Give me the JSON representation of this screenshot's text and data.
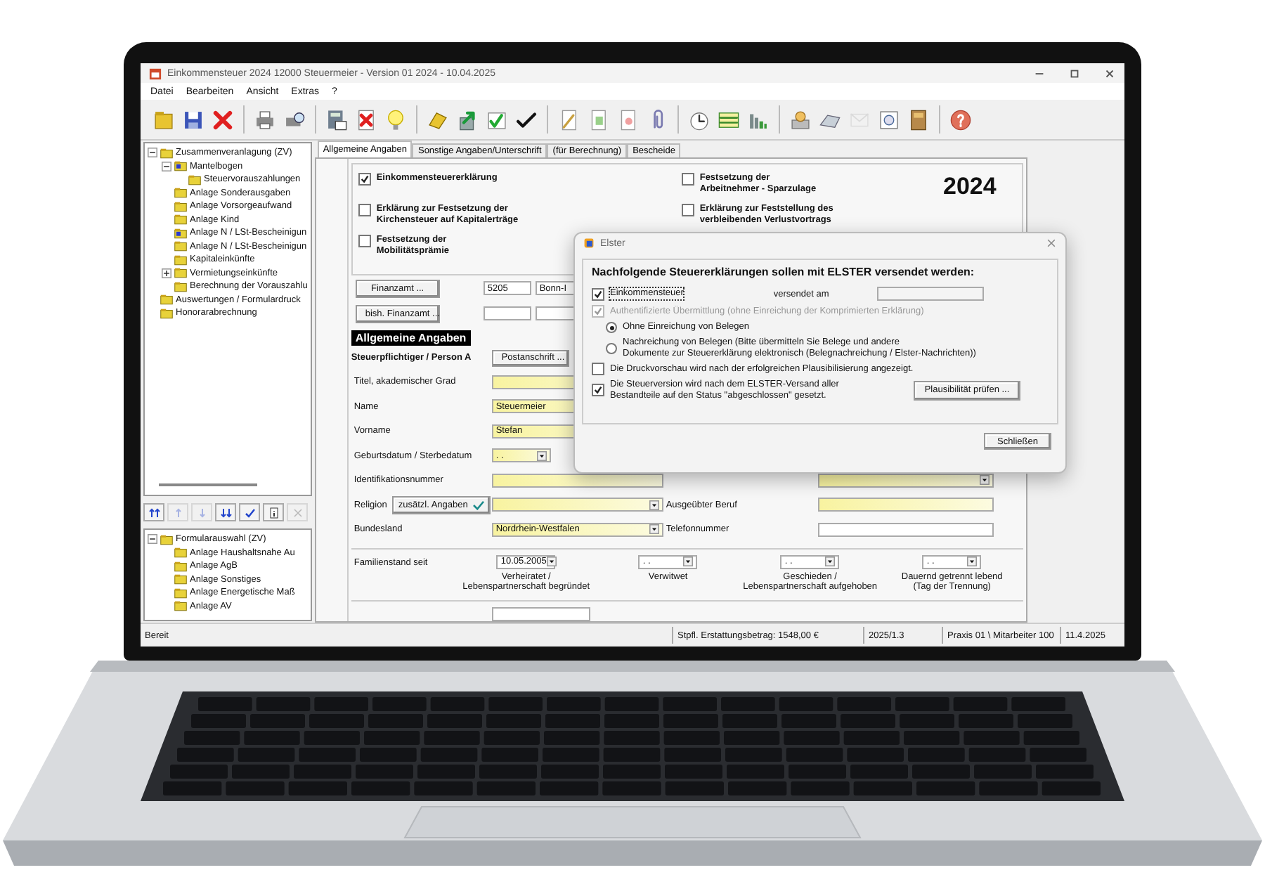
{
  "window": {
    "title": "Einkommensteuer 2024 12000 Steuermeier - Version 01 2024 - 10.04.2025"
  },
  "menu": [
    "Datei",
    "Bearbeiten",
    "Ansicht",
    "Extras",
    "?"
  ],
  "toolbar": [
    {
      "disabled": false
    },
    {
      "disabled": false
    },
    {
      "disabled": false
    },
    {
      "disabled": false
    },
    {
      "disabled": false
    },
    {
      "disabled": false
    },
    {
      "disabled": false
    },
    {
      "disabled": false
    },
    {
      "disabled": false
    },
    {
      "disabled": false
    },
    {
      "disabled": false
    },
    {
      "disabled": false
    },
    {
      "disabled": false
    },
    {
      "disabled": false
    },
    {
      "disabled": false
    },
    {
      "disabled": false
    },
    {
      "disabled": false
    },
    {
      "disabled": false
    },
    {
      "disabled": false
    },
    {
      "disabled": false
    },
    {
      "disabled": false
    },
    {
      "disabled": true
    },
    {
      "disabled": false
    },
    {
      "disabled": false
    },
    {
      "disabled": false
    }
  ],
  "navigation_tree": [
    {
      "label": "Zusammenveranlagung (ZV)",
      "marked": false,
      "expanded": true,
      "children": [
        {
          "label": "Mantelbogen",
          "marked": true,
          "expanded": true,
          "children": [
            {
              "label": "Steuervorauszahlungen",
              "marked": false
            }
          ]
        },
        {
          "label": "Anlage Sonderausgaben",
          "marked": false
        },
        {
          "label": "Anlage Vorsorgeaufwand",
          "marked": false
        },
        {
          "label": "Anlage Kind",
          "marked": false
        },
        {
          "label": "Anlage N / LSt-Bescheinigun",
          "marked": true
        },
        {
          "label": "Anlage N / LSt-Bescheinigun",
          "marked": false
        },
        {
          "label": "Kapitaleinkünfte",
          "marked": false
        },
        {
          "label": "Vermietungseinkünfte",
          "marked": false,
          "expanded": false
        },
        {
          "label": "Berechnung der Vorauszahlu",
          "marked": false
        }
      ]
    },
    {
      "label": "Auswertungen / Formulardruck",
      "marked": false
    },
    {
      "label": "Honorarabrechnung",
      "marked": false
    }
  ],
  "tree_toolbar": [
    {
      "disabled": false
    },
    {
      "disabled": true
    },
    {
      "disabled": true
    },
    {
      "disabled": false
    },
    {
      "disabled": false
    },
    {
      "disabled": false
    },
    {
      "disabled": true
    }
  ],
  "form_tree": [
    {
      "label": "Formularauswahl (ZV)",
      "marked": false,
      "expanded": true,
      "children": [
        {
          "label": "Anlage Haushaltsnahe Au",
          "marked": false
        },
        {
          "label": "Anlage AgB",
          "marked": false
        },
        {
          "label": "Anlage Sonstiges",
          "marked": false
        },
        {
          "label": "Anlage Energetische Maß",
          "marked": false
        },
        {
          "label": "Anlage AV",
          "marked": false
        }
      ]
    }
  ],
  "tabs": [
    {
      "label": "Allgemeine Angaben",
      "selected": true
    },
    {
      "label": "Sonstige Angaben/Unterschrift",
      "selected": false
    },
    {
      "label": "(für Berechnung)",
      "selected": false
    },
    {
      "label": "Bescheide",
      "selected": false
    }
  ],
  "declarations": [
    {
      "label": "Einkommensteuererklärung",
      "checked": true
    },
    {
      "label": "Erklärung zur Festsetzung der\nKirchensteuer auf Kapitalerträge",
      "checked": false
    },
    {
      "label": "Festsetzung der\nMobilitätsprämie",
      "checked": false
    },
    {
      "label": "Festsetzung der\nArbeitnehmer - Sparzulage",
      "checked": false
    },
    {
      "label": "Erklärung zur Feststellung des\nverbleibenden Verlustvortrags",
      "checked": false
    }
  ],
  "year": "2024",
  "tax_office": {
    "button": "Finanzamt ...",
    "number": "5205",
    "name": "Bonn-I"
  },
  "previous_tax_office": {
    "button": "bish. Finanzamt ..."
  },
  "section_title": "Allgemeine Angaben",
  "person": {
    "heading": "Steuerpflichtiger / Person A",
    "address_button": "Postanschrift ..."
  },
  "fields": [
    {
      "label": "Titel, akademischer Grad",
      "kind": "text",
      "required": true
    },
    {
      "label": "Name",
      "kind": "text",
      "required": true,
      "value": "Steuermeier"
    },
    {
      "label": "Vorname",
      "kind": "text",
      "required": true,
      "value": "Stefan"
    },
    {
      "label": "Geburtsdatum / Sterbedatum",
      "kind": "date",
      "required": true,
      "value": ". ."
    },
    {
      "label": "Identifikationsnummer",
      "kind": "text",
      "required": true
    },
    {
      "label": "Religion",
      "kind": "dropdown",
      "required": true,
      "button": "zusätzl. Angaben"
    },
    {
      "label": "Bundesland",
      "kind": "dropdown",
      "required": true,
      "value": "Nordrhein-Westfalen"
    }
  ],
  "right_fields": [
    {
      "kind": "dropdown",
      "required": true
    },
    {
      "label": "Ausgeübter Beruf",
      "kind": "text",
      "required": true
    },
    {
      "label": "Telefonnummer",
      "kind": "text",
      "required": false
    }
  ],
  "family_status": {
    "label": "Familienstand seit",
    "dates": [
      {
        "value": "10.05.2005",
        "caption": "Verheiratet /\nLebenspartnerschaft begründet"
      },
      {
        "value": ". .",
        "caption": "Verwitwet"
      },
      {
        "value": ". .",
        "caption": "Geschieden /\nLebenspartnerschaft aufgehoben"
      },
      {
        "value": ". .",
        "caption": "Dauernd getrennt lebend\n(Tag der Trennung)"
      }
    ]
  },
  "status_bar": [
    "Bereit",
    "Stpfl. Erstattungsbetrag: 1548,00 €",
    "2025/1.3",
    "Praxis 01 \\ Mitarbeiter 100",
    "11.4.2025"
  ],
  "dialog": {
    "title": "Elster",
    "heading": "Nachfolgende Steuererklärungen sollen mit ELSTER versendet werden:",
    "return": {
      "label": "Einkommensteuer",
      "checked": true,
      "date_label": "versendet am"
    },
    "authenticated": {
      "label": "Authentifizierte Übermittlung (ohne Einreichung der Komprimierten Erklärung)",
      "checked": true,
      "disabled": true
    },
    "receipts": [
      {
        "label": "Ohne Einreichung von Belegen",
        "selected": true
      },
      {
        "label": "Nachreichung von Belegen (Bitte übermitteln Sie Belege und andere\nDokumente zur Steuererklärung elektronisch (Belegnachreichung / Elster-Nachrichten))",
        "selected": false
      }
    ],
    "options": [
      {
        "label": "Die Druckvorschau wird nach der erfolgreichen Plausibilisierung angezeigt.",
        "checked": false
      },
      {
        "label": "Die Steuerversion wird nach dem ELSTER-Versand aller\nBestandteile auf den Status \"abgeschlossen\" gesetzt.",
        "checked": true
      }
    ],
    "check_button": "Plausibilität prüfen ...",
    "close_button": "Schließen"
  }
}
